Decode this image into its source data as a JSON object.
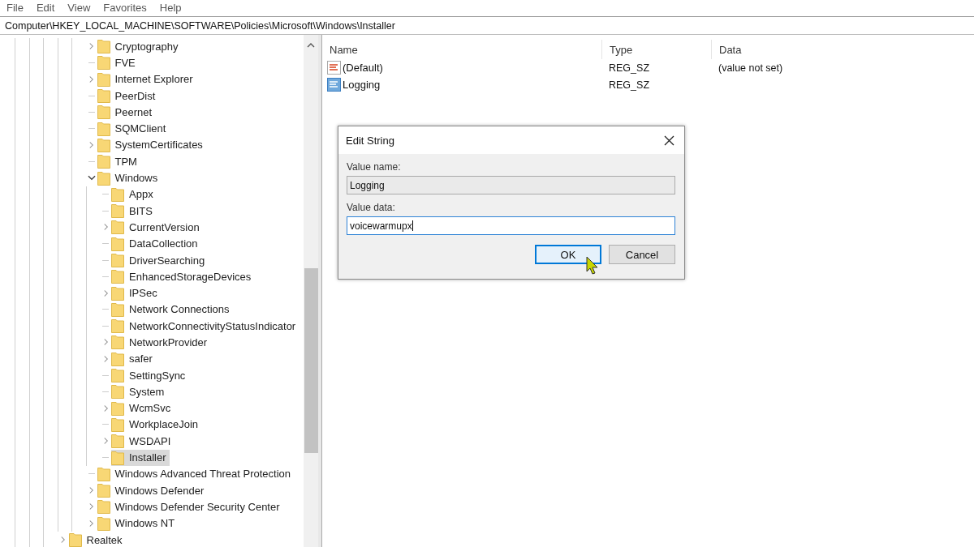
{
  "menu": [
    "File",
    "Edit",
    "View",
    "Favorites",
    "Help"
  ],
  "address": "Computer\\HKEY_LOCAL_MACHINE\\SOFTWARE\\Policies\\Microsoft\\Windows\\Installer",
  "tree": {
    "nested_items": [
      {
        "label": "Cryptography",
        "expanded": false,
        "selected": false
      },
      {
        "label": "FVE",
        "selected": false
      },
      {
        "label": "Internet Explorer",
        "expanded": false,
        "selected": false
      },
      {
        "label": "PeerDist",
        "selected": false
      },
      {
        "label": "Peernet",
        "selected": false
      },
      {
        "label": "SQMClient",
        "selected": false
      },
      {
        "label": "SystemCertificates",
        "expanded": false,
        "selected": false
      },
      {
        "label": "TPM",
        "selected": false
      },
      {
        "label": "Windows",
        "expanded": true,
        "selected": false,
        "children": [
          {
            "label": "Appx",
            "selected": false
          },
          {
            "label": "BITS",
            "selected": false
          },
          {
            "label": "CurrentVersion",
            "expanded": false,
            "selected": false
          },
          {
            "label": "DataCollection",
            "selected": false
          },
          {
            "label": "DriverSearching",
            "selected": false
          },
          {
            "label": "EnhancedStorageDevices",
            "selected": false
          },
          {
            "label": "IPSec",
            "expanded": false,
            "selected": false
          },
          {
            "label": "Network Connections",
            "selected": false
          },
          {
            "label": "NetworkConnectivityStatusIndicator",
            "selected": false
          },
          {
            "label": "NetworkProvider",
            "expanded": false,
            "selected": false
          },
          {
            "label": "safer",
            "expanded": false,
            "selected": false
          },
          {
            "label": "SettingSync",
            "selected": false
          },
          {
            "label": "System",
            "selected": false
          },
          {
            "label": "WcmSvc",
            "expanded": false,
            "selected": false
          },
          {
            "label": "WorkplaceJoin",
            "selected": false
          },
          {
            "label": "WSDAPI",
            "expanded": false,
            "selected": false
          },
          {
            "label": "Installer",
            "selected": true
          }
        ]
      },
      {
        "label": "Windows Advanced Threat Protection",
        "selected": false
      },
      {
        "label": "Windows Defender",
        "expanded": false,
        "selected": false
      },
      {
        "label": "Windows Defender Security Center",
        "expanded": false,
        "selected": false
      },
      {
        "label": "Windows NT",
        "expanded": false,
        "selected": false
      }
    ],
    "items": [
      {
        "label": "Realtek",
        "expanded": false,
        "selected": false
      }
    ]
  },
  "values": {
    "columns": [
      "Name",
      "Type",
      "Data"
    ],
    "rows": [
      {
        "name": "(Default)",
        "type": "REG_SZ",
        "data": "(value not set)",
        "selected": false
      },
      {
        "name": "Logging",
        "type": "REG_SZ",
        "selected": true
      }
    ]
  },
  "dialog": {
    "title": "Edit String",
    "name_label": "Value name:",
    "name_value": "Logging",
    "data_label": "Value data:",
    "data_value": "voicewarmupx",
    "buttons": [
      {
        "label": "OK",
        "default": true
      },
      {
        "label": "Cancel",
        "default": false
      }
    ]
  }
}
